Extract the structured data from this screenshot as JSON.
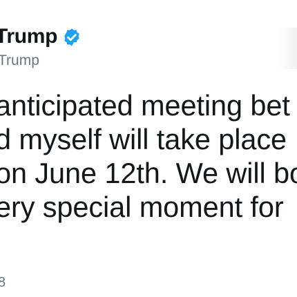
{
  "tweet": {
    "author_name": "Trump",
    "author_handle": "Trump",
    "verified_icon": "verified-badge-icon",
    "text_lines": [
      "anticipated meeting bet",
      "d myself will take place",
      "on June 12th. We will bo",
      "ery special moment for "
    ],
    "date_fragment": "8"
  },
  "colors": {
    "text": "#14171a",
    "secondary_text": "#657786",
    "verified_blue": "#1da1f2",
    "background": "#ffffff"
  }
}
